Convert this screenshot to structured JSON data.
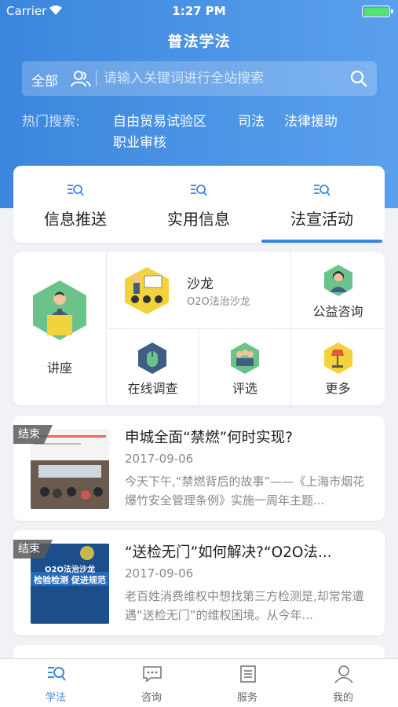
{
  "status_bar": {
    "carrier": "Carrier",
    "time": "1:27 PM"
  },
  "header": {
    "title": "普法学法"
  },
  "search": {
    "scope": "全部",
    "placeholder": "请输入关键词进行全站搜索"
  },
  "hot_search": {
    "label": "热门搜索:",
    "terms": [
      "自由贸易试验区",
      "司法",
      "法律援助",
      "职业审核"
    ]
  },
  "tabs": [
    {
      "label": "信息推送",
      "active": false
    },
    {
      "label": "实用信息",
      "active": false
    },
    {
      "label": "法宣活动",
      "active": true
    }
  ],
  "activities": {
    "lecture": {
      "label": "讲座"
    },
    "salon": {
      "label": "沙龙",
      "sub": "O2O法治沙龙"
    },
    "consult": {
      "label": "公益咨询"
    },
    "survey": {
      "label": "在线调查"
    },
    "selection": {
      "label": "评选"
    },
    "more": {
      "label": "更多"
    }
  },
  "news": [
    {
      "tag": "结束",
      "title": "申城全面“禁燃”何时实现?",
      "date": "2017-09-06",
      "desc": "今天下午,“禁燃背后的故事”——《上海市烟花爆竹安全管理条例》实施一周年主题..."
    },
    {
      "tag": "结束",
      "title": "“送检无门”如何解决?“O2O法...",
      "date": "2017-09-06",
      "desc": "老百姓消费维权中想找第三方检测是,却常常遭遇“送检无门”的维权困境。从今年...",
      "thumb_text": "O2O法治沙龙",
      "thumb_banner": "检验检测 促进规范"
    }
  ],
  "tabbar": [
    {
      "label": "学法",
      "active": true,
      "icon": "book-search-icon"
    },
    {
      "label": "咨询",
      "active": false,
      "icon": "chat-icon"
    },
    {
      "label": "服务",
      "active": false,
      "icon": "list-icon"
    },
    {
      "label": "我的",
      "active": false,
      "icon": "person-icon"
    }
  ],
  "colors": {
    "accent": "#3b86dd",
    "background": "#f1f2f5"
  }
}
